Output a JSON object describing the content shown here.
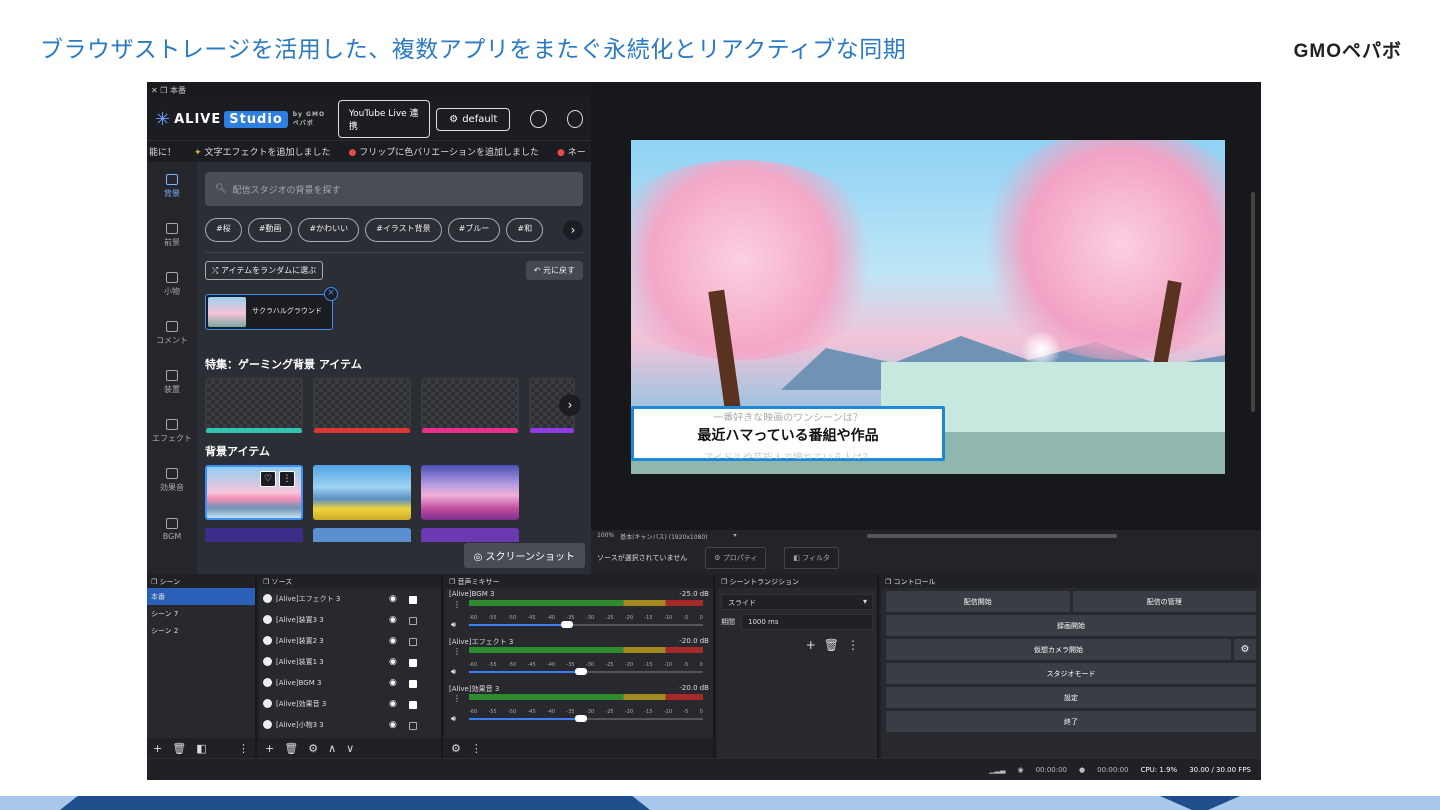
{
  "slide": {
    "title": "ブラウザストレージを活用した、複数アプリをまたぐ永続化とリアクティブな同期",
    "brand": "GMOペパボ"
  },
  "window": {
    "title": "本番",
    "close_glyph": "✕"
  },
  "header": {
    "logo_text": "ALIVE",
    "logo_studio": "Studio",
    "logo_by": "by GMOペパボ",
    "youtube_button": "YouTube Live 連携",
    "profile_button": "default"
  },
  "ticker": {
    "items": [
      "能に！",
      "文字エフェクトを追加しました",
      "フリップに色バリエーションを追加しました",
      "ネー"
    ]
  },
  "sidebar": {
    "items": [
      {
        "label": "背景",
        "active": true
      },
      {
        "label": "前景",
        "active": false
      },
      {
        "label": "小物",
        "active": false
      },
      {
        "label": "コメント",
        "active": false
      },
      {
        "label": "装置",
        "active": false
      },
      {
        "label": "エフェクト",
        "active": false
      },
      {
        "label": "効果音",
        "active": false
      },
      {
        "label": "BGM",
        "active": false
      }
    ]
  },
  "content": {
    "search_placeholder": "配信スタジオの背景を探す",
    "tags": [
      "#桜",
      "#動画",
      "#かわいい",
      "#イラスト背景",
      "#ブルー",
      "#和"
    ],
    "random_button": "アイテムをランダムに選ぶ",
    "reset_button": "元に戻す",
    "selected_item": "サクラハルグラウンド",
    "feature_title": "特集：ゲーミング背景 アイテム",
    "bg_title": "背景アイテム",
    "screenshot_button": "スクリーンショット"
  },
  "preview": {
    "lowerthird_top": "一番好きな映画のワンシーンは？",
    "lowerthird_main": "最近ハマっている番組や作品",
    "lowerthird_bottom": "アイドルや芸能人で憧れている人は？",
    "zoom_label": "100%",
    "canvas_label": "基本(キャンバス) (1920x1080)",
    "no_source": "ソースが選択されていません",
    "properties_button": "プロパティ",
    "filter_button": "フィルタ"
  },
  "scenes": {
    "title": "シーン",
    "items": [
      {
        "label": "本番",
        "active": true
      },
      {
        "label": "シーン 7",
        "active": false
      },
      {
        "label": "シーン 2",
        "active": false
      }
    ]
  },
  "sources": {
    "title": "ソース",
    "items": [
      {
        "label": "[Alive]エフェクト 3",
        "locked": true
      },
      {
        "label": "[Alive]装置3 3",
        "locked": false
      },
      {
        "label": "[Alive]装置2 3",
        "locked": false
      },
      {
        "label": "[Alive]装置1 3",
        "locked": true
      },
      {
        "label": "[Alive]BGM 3",
        "locked": true
      },
      {
        "label": "[Alive]効果音 3",
        "locked": true
      },
      {
        "label": "[Alive]小物3 3",
        "locked": false
      }
    ]
  },
  "mixer": {
    "title": "音声ミキサー",
    "scale": [
      "-60",
      "-55",
      "-50",
      "-45",
      "-40",
      "-35",
      "-30",
      "-25",
      "-20",
      "-15",
      "-10",
      "-5",
      "0"
    ],
    "channels": [
      {
        "name": "[Alive]BGM 3",
        "db": "-25.0 dB",
        "level": 0.42
      },
      {
        "name": "[Alive]エフェクト 3",
        "db": "-20.0 dB",
        "level": 0.48
      },
      {
        "name": "[Alive]効果音 3",
        "db": "-20.0 dB",
        "level": 0.48
      }
    ]
  },
  "transition": {
    "title": "シーントランジション",
    "selected": "スライド",
    "duration_label": "期間",
    "duration_value": "1000 ms"
  },
  "controls": {
    "title": "コントロール",
    "start_stream": "配信開始",
    "manage_stream": "配信の管理",
    "start_record": "録画開始",
    "virtual_cam": "仮想カメラ開始",
    "studio_mode": "スタジオモード",
    "settings": "設定",
    "exit": "終了"
  },
  "status": {
    "stream_time": "00:00:00",
    "record_time": "00:00:00",
    "cpu": "CPU: 1.9%",
    "fps": "30.00 / 30.00 FPS"
  },
  "colors": {
    "title_blue": "#2a7bc4",
    "accent": "#3e8ef7",
    "scene_active": "#2b5fb8"
  }
}
